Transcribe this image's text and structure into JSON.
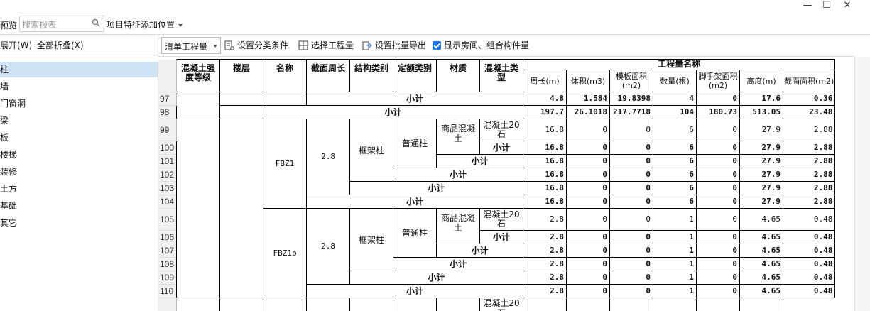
{
  "window": {
    "minimize": "—",
    "maximize": "☐",
    "close": "✕"
  },
  "toprow": {
    "preview_label": "预览",
    "search_placeholder": "搜索报表",
    "project_feature_label": "项目特征添加位置"
  },
  "left_panel": {
    "expand_label": "展开(W)",
    "collapse_label": "全部折叠(X)",
    "tree_items": [
      {
        "label": "柱",
        "selected": true
      },
      {
        "label": "墙",
        "selected": false
      },
      {
        "label": "门窗洞",
        "selected": false
      },
      {
        "label": "梁",
        "selected": false
      },
      {
        "label": "板",
        "selected": false
      },
      {
        "label": "楼梯",
        "selected": false
      },
      {
        "label": "装修",
        "selected": false
      },
      {
        "label": "土方",
        "selected": false
      },
      {
        "label": "基础",
        "selected": false
      },
      {
        "label": "其它",
        "selected": false
      }
    ]
  },
  "toolbar": {
    "quantity_type": "清单工程量",
    "set_category": "设置分类条件",
    "select_project": "选择工程量",
    "batch_export": "设置批量导出",
    "show_rooms": "显示房间、组合构件量",
    "show_rooms_checked": true
  },
  "table": {
    "headers": {
      "grade": "混凝土强度等级",
      "floor": "楼层",
      "name": "名称",
      "perimeter": "截面周长",
      "struct_type": "结构类别",
      "quota_type": "定额类别",
      "material": "材质",
      "concrete_type": "混凝土类型",
      "quantity_group": "工程量名称",
      "cols": [
        "周长(m)",
        "体积(m3)",
        "模板面积(m2)",
        "数量(根)",
        "脚手架面积(m2)",
        "高度(m)",
        "截面面积(m2)"
      ]
    },
    "subtotal_label": "小计",
    "struct_label": "框架柱",
    "quota_label": "普通柱",
    "material_label": "商品混凝土",
    "concrete_label": "混凝土20石",
    "row_numbers": [
      "97",
      "98",
      "99",
      "100",
      "101",
      "102",
      "103",
      "104",
      "105",
      "106",
      "107",
      "108",
      "109",
      "110"
    ],
    "r97": [
      "4.8",
      "1.584",
      "19.8398",
      "4",
      "0",
      "17.6",
      "0.36"
    ],
    "r98": [
      "197.7",
      "26.1018",
      "217.7718",
      "104",
      "180.73",
      "513.05",
      "23.48"
    ],
    "fbz1": {
      "name": "FBZ1",
      "perimeter": "2.8",
      "detail": [
        "16.8",
        "0",
        "0",
        "6",
        "0",
        "27.9",
        "2.88"
      ],
      "total": [
        "16.8",
        "0",
        "0",
        "6",
        "0",
        "27.9",
        "2.88"
      ]
    },
    "fbz1b": {
      "name": "FBZ1b",
      "perimeter": "2.8",
      "detail": [
        "2.8",
        "0",
        "0",
        "1",
        "0",
        "4.65",
        "0.48"
      ],
      "total": [
        "2.8",
        "0",
        "0",
        "1",
        "0",
        "4.65",
        "0.48"
      ]
    }
  }
}
